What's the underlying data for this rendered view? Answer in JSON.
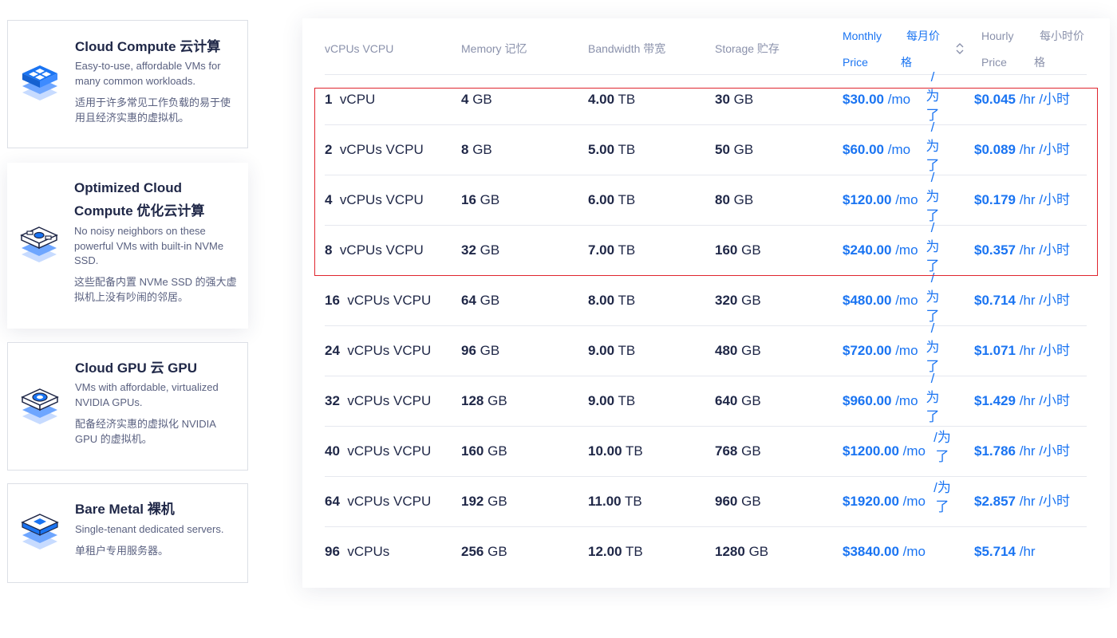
{
  "sidebar": [
    {
      "title": "Cloud Compute  云计算",
      "desc": "Easy-to-use, affordable VMs for many common workloads.",
      "zh": "适用于许多常见工作负载的易于使用且经济实惠的虚拟机。",
      "icon": "stacked-server-icon"
    },
    {
      "title": "Optimized Cloud Compute  优化云计算",
      "desc": "No noisy neighbors on these powerful VMs with built-in NVMe SSD.",
      "zh": "这些配备内置 NVMe SSD 的强大虚拟机上没有吵闹的邻居。",
      "icon": "optimized-server-icon"
    },
    {
      "title": "Cloud GPU  云 GPU",
      "desc": "VMs with affordable, virtualized NVIDIA GPUs.",
      "zh": "配备经济实惠的虚拟化 NVIDIA GPU 的虚拟机。",
      "icon": "gpu-chip-icon"
    },
    {
      "title": "Bare Metal  裸机",
      "desc": "Single-tenant dedicated servers.",
      "zh": "单租户专用服务器。",
      "icon": "bare-metal-icon"
    }
  ],
  "table": {
    "headers": {
      "vcpu": "vCPUs  VCPU",
      "memory": "Memory  记忆",
      "bandwidth": "Bandwidth  带宽",
      "storage": "Storage  贮存",
      "monthly_en_1": "Monthly",
      "monthly_zh_1": "每月价",
      "monthly_en_2": "Price",
      "monthly_zh_2": "格",
      "hourly_en_1": "Hourly",
      "hourly_zh_1": "每小时价",
      "hourly_en_2": "Price",
      "hourly_zh_2": "格"
    },
    "rows": [
      {
        "n": "1",
        "unit": "vCPU",
        "mem": "4",
        "bw": "4.00",
        "st": "30",
        "mo": "$30.00",
        "mo_zh": "/ 为了",
        "hr": "$0.045",
        "hr_zh": "/小时"
      },
      {
        "n": "2",
        "unit": "vCPUs  VCPU",
        "mem": "8",
        "bw": "5.00",
        "st": "50",
        "mo": "$60.00",
        "mo_zh": "/ 为了",
        "hr": "$0.089",
        "hr_zh": "/小时"
      },
      {
        "n": "4",
        "unit": "vCPUs  VCPU",
        "mem": "16",
        "bw": "6.00",
        "st": "80",
        "mo": "$120.00",
        "mo_zh": "/ 为了",
        "hr": "$0.179",
        "hr_zh": "/小时"
      },
      {
        "n": "8",
        "unit": "vCPUs  VCPU",
        "mem": "32",
        "bw": "7.00",
        "st": "160",
        "mo": "$240.00",
        "mo_zh": "/ 为了",
        "hr": "$0.357",
        "hr_zh": "/小时"
      },
      {
        "n": "16",
        "unit": "vCPUs  VCPU",
        "mem": "64",
        "bw": "8.00",
        "st": "320",
        "mo": "$480.00",
        "mo_zh": "/ 为了",
        "hr": "$0.714",
        "hr_zh": "/小时"
      },
      {
        "n": "24",
        "unit": "vCPUs  VCPU",
        "mem": "96",
        "bw": "9.00",
        "st": "480",
        "mo": "$720.00",
        "mo_zh": "/ 为了",
        "hr": "$1.071",
        "hr_zh": "/小时"
      },
      {
        "n": "32",
        "unit": "vCPUs  VCPU",
        "mem": "128",
        "bw": "9.00",
        "st": "640",
        "mo": "$960.00",
        "mo_zh": "/ 为了",
        "hr": "$1.429",
        "hr_zh": "/小时"
      },
      {
        "n": "40",
        "unit": "vCPUs  VCPU",
        "mem": "160",
        "bw": "10.00",
        "st": "768",
        "mo": "$1200.00",
        "mo_zh": "/为了",
        "hr": "$1.786",
        "hr_zh": "/小时"
      },
      {
        "n": "64",
        "unit": "vCPUs  VCPU",
        "mem": "192",
        "bw": "11.00",
        "st": "960",
        "mo": "$1920.00",
        "mo_zh": "/为了",
        "hr": "$2.857",
        "hr_zh": "/小时"
      },
      {
        "n": "96",
        "unit": "vCPUs",
        "mem": "256",
        "bw": "12.00",
        "st": "1280",
        "mo": "$3840.00",
        "mo_zh": "",
        "hr": "$5.714",
        "hr_zh": ""
      }
    ],
    "units": {
      "memory": "GB",
      "bandwidth": "TB",
      "storage": "GB",
      "per_month": "/mo",
      "per_hour": "/hr"
    }
  },
  "colors": {
    "accent": "#1a74f2",
    "highlight": "#e0262f",
    "text": "#1f2747",
    "muted": "#8a91ab"
  }
}
